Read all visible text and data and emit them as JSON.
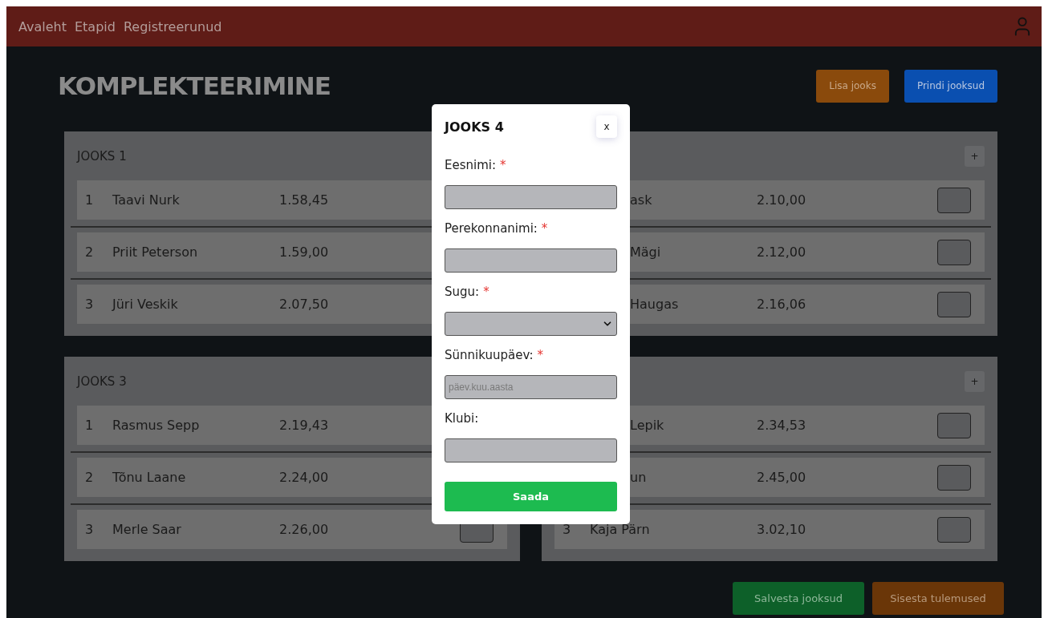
{
  "nav": {
    "links": [
      {
        "label": "Avaleht"
      },
      {
        "label": "Etapid"
      },
      {
        "label": "Registreerunud"
      }
    ]
  },
  "page": {
    "title": "KOMPLEKTEERIMINE",
    "actions": [
      {
        "label": "Lisa jooks",
        "kind": "add"
      },
      {
        "label": "Prindi jooksud",
        "kind": "print"
      }
    ]
  },
  "heats": [
    {
      "title": "JOOKS 1",
      "rows": [
        {
          "number": "1",
          "name": "Taavi Nurk",
          "time": "1.58,45"
        },
        {
          "number": "2",
          "name": "Priit Peterson",
          "time": "1.59,00"
        },
        {
          "number": "3",
          "name": "Jüri Veskik",
          "time": "2.07,50"
        }
      ]
    },
    {
      "add_label": "+",
      "rows": [
        {
          "name": "ask",
          "time": "2.10,00",
          "result_input": true
        },
        {
          "name": "Mägi",
          "time": "2.12,00",
          "result_input": true
        },
        {
          "name": "Haugas",
          "time": "2.16,06",
          "result_input": true
        }
      ]
    },
    {
      "title": "JOOKS 3",
      "rows": [
        {
          "number": "1",
          "name": "Rasmus Sepp",
          "time": "2.19,43"
        },
        {
          "number": "2",
          "name": "Tõnu Laane",
          "time": "2.24,00"
        },
        {
          "number": "3",
          "name": "Merle Saar",
          "time": "2.26,00",
          "result_input": true
        }
      ]
    },
    {
      "add_label": "+",
      "rows": [
        {
          "name": "Lepik",
          "time": "2.34,53",
          "result_input": true
        },
        {
          "name": "un",
          "time": "2.45,00",
          "result_input": true
        },
        {
          "number": "3",
          "name": "Kaja Pärn",
          "time": "3.02,10",
          "result_input": true
        }
      ]
    }
  ],
  "footer_actions": [
    {
      "label": "Salvesta jooksud",
      "kind": "save"
    },
    {
      "label": "Sisesta tulemused",
      "kind": "results"
    }
  ],
  "modal": {
    "title": "JOOKS 4",
    "close": "x",
    "fields": [
      {
        "label": "Eesnimi:",
        "required": true,
        "kind": "text"
      },
      {
        "label": "Perekonnanimi:",
        "required": true,
        "kind": "text"
      },
      {
        "label": "Sugu:",
        "required": true,
        "kind": "select"
      },
      {
        "label": "Sünnikuupäev:",
        "required": true,
        "kind": "date",
        "placeholder": "päev.kuu.aasta"
      },
      {
        "label": "Klubi:",
        "required": false,
        "kind": "text"
      }
    ],
    "required_mark": "*",
    "submit": "Saada"
  }
}
